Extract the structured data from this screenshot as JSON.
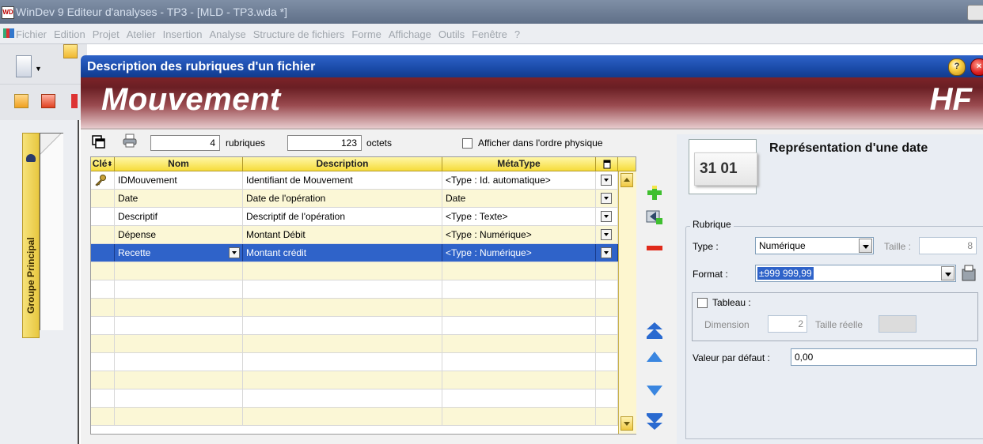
{
  "app": {
    "title": "WinDev 9 Editeur d'analyses - TP3 - [MLD - TP3.wda *]",
    "logo_text": "WD",
    "menu": [
      "Fichier",
      "Edition",
      "Projet",
      "Atelier",
      "Insertion",
      "Analyse",
      "Structure de fichiers",
      "Forme",
      "Affichage",
      "Outils",
      "Fenêtre",
      "?"
    ]
  },
  "sidebar": {
    "tab_label": "Groupe Principal"
  },
  "dialog": {
    "title": "Description des rubriques d'un fichier",
    "file_name": "Mouvement",
    "file_type": "HF",
    "help_glyph": "?",
    "close_glyph": "×"
  },
  "toolbar": {
    "rubriques_count": "4",
    "rubriques_label": "rubriques",
    "octets_count": "123",
    "octets_label": "octets",
    "physical_order_label": "Afficher dans l'ordre physique",
    "physical_order_checked": false
  },
  "grid": {
    "headers": {
      "cle": "Clé",
      "nom": "Nom",
      "description": "Description",
      "metatype": "MétaType"
    },
    "rows": [
      {
        "key": true,
        "nom": "IDMouvement",
        "description": "Identifiant de Mouvement",
        "metatype": "<Type : Id. automatique>",
        "selected": false
      },
      {
        "key": false,
        "nom": "Date",
        "description": "Date de l'opération",
        "metatype": "Date",
        "selected": false
      },
      {
        "key": false,
        "nom": "Descriptif",
        "description": "Descriptif de l'opération",
        "metatype": "<Type : Texte>",
        "selected": false
      },
      {
        "key": false,
        "nom": "Dépense",
        "description": "Montant Débit",
        "metatype": "<Type : Numérique>",
        "selected": false
      },
      {
        "key": false,
        "nom": "Recette",
        "description": "Montant crédit",
        "metatype": "<Type : Numérique>",
        "selected": true
      }
    ],
    "empty_rows": 9
  },
  "right_panel": {
    "preview_date": "31 01",
    "title": "Représentation d'une date",
    "rubrique_group_label": "Rubrique",
    "type_label": "Type :",
    "type_value": "Numérique",
    "taille_label": "Taille :",
    "taille_value": "8",
    "format_label": "Format :",
    "format_value": "±999 999,99",
    "tableau_label": "Tableau :",
    "tableau_checked": false,
    "dimension_label": "Dimension",
    "dimension_value": "2",
    "taille_reelle_label": "Taille réelle",
    "taille_reelle_value": "",
    "defaut_label": "Valeur par défaut :",
    "defaut_value": "0,00"
  },
  "colors": {
    "selection": "#2f63c9",
    "header_yellow": "#f6dc3a",
    "banner": "#7c2328",
    "dialog_title": "#1a4aa8"
  }
}
